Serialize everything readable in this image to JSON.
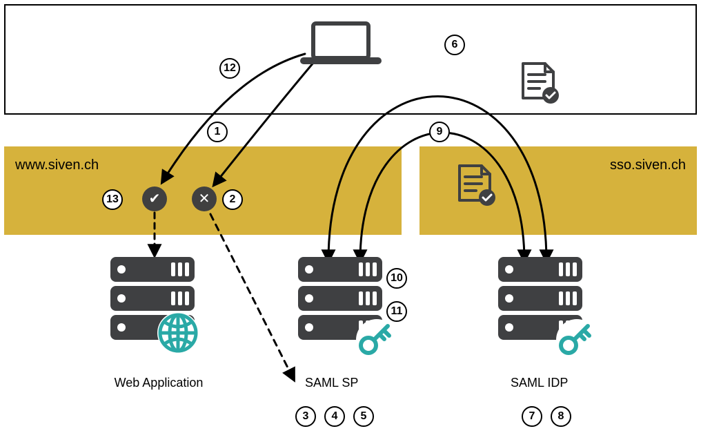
{
  "domains": {
    "left_label": "www.siven.ch",
    "right_label": "sso.siven.ch"
  },
  "nodes": {
    "webapp": "Web Application",
    "sp": "SAML SP",
    "idp": "SAML IDP"
  },
  "steps": {
    "s1": "1",
    "s2": "2",
    "s3": "3",
    "s4": "4",
    "s5": "5",
    "s6": "6",
    "s7": "7",
    "s8": "8",
    "s9": "9",
    "s10": "10",
    "s11": "11",
    "s12": "12",
    "s13": "13"
  },
  "status": {
    "ok_glyph": "✔",
    "no_glyph": "✕"
  },
  "colors": {
    "accent": "#2aa9a6",
    "dark": "#3f4042",
    "yellow": "#d6b23c"
  }
}
